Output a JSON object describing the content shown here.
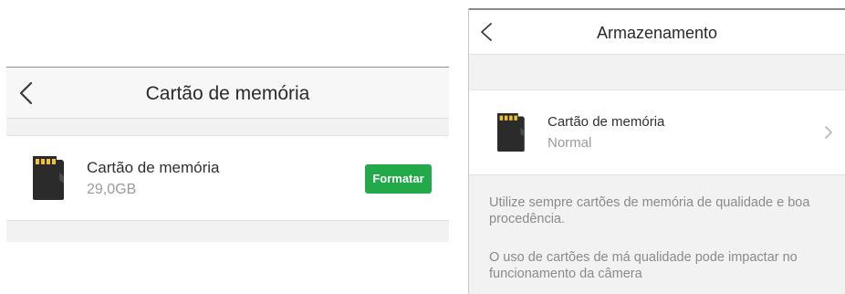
{
  "left_screen": {
    "header": {
      "back_icon": "chevron-left-icon",
      "title": "Cartão de memória"
    },
    "memory_card": {
      "icon": "sd-card-icon",
      "title": "Cartão de memória",
      "capacity": "29,0GB",
      "format_button": "Formatar"
    },
    "colors": {
      "format_button_bg": "#22a94a"
    }
  },
  "right_screen": {
    "header": {
      "back_icon": "chevron-left-icon",
      "title": "Armazenamento"
    },
    "memory_card": {
      "icon": "sd-card-icon",
      "title": "Cartão de memória",
      "status": "Normal",
      "chevron_icon": "chevron-right-icon"
    },
    "info": [
      "Utilize sempre cartões de memória de qualidade e boa procedência.",
      "O uso de cartões de má qualidade pode impactar no funcionamento da câmera"
    ]
  }
}
